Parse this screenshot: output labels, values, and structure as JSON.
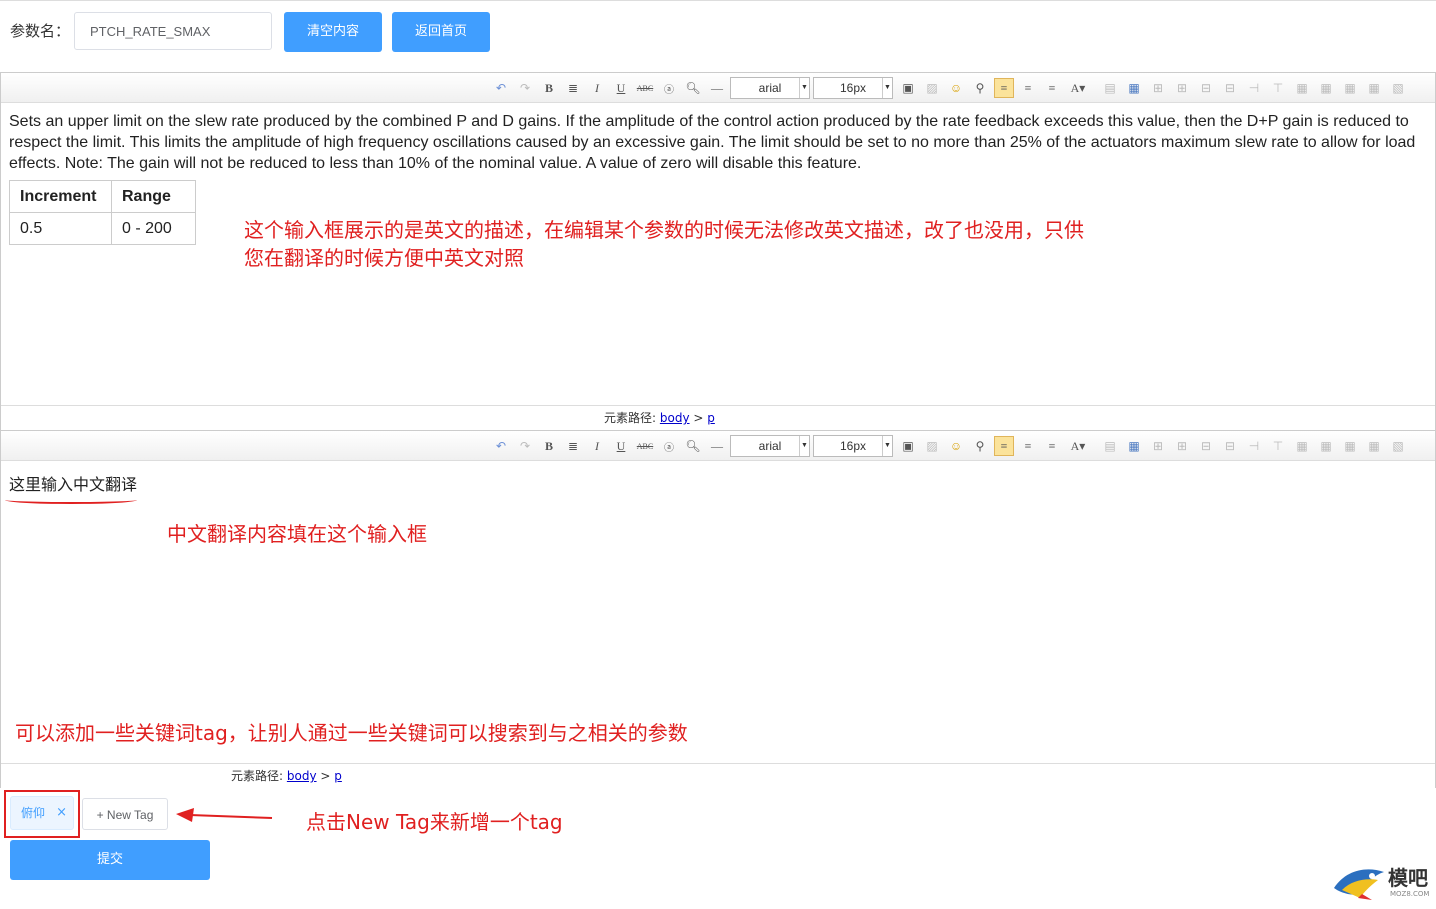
{
  "header": {
    "param_label": "参数名：",
    "param_value": "PTCH_RATE_SMAX",
    "clear_button": "清空内容",
    "home_button": "返回首页"
  },
  "toolbar": {
    "font_name": "arial",
    "font_size": "16px"
  },
  "editor_en": {
    "description": "Sets an upper limit on the slew rate produced by the combined P and D gains. If the amplitude of the control action produced by the rate feedback exceeds this value, then the D+P gain is reduced to respect the limit. This limits the amplitude of high frequency oscillations caused by an excessive gain. The limit should be set to no more than 25% of the actuators maximum slew rate to allow for load effects. Note: The gain will not be reduced to less than 10% of the nominal value. A value of zero will disable this feature.",
    "table_headers": [
      "Increment",
      "Range"
    ],
    "table_values": [
      "0.5",
      "0 - 200"
    ],
    "annotation_line1": "这个输入框展示的是英文的描述，在编辑某个参数的时候无法修改英文描述，改了也没用，只供",
    "annotation_line2": "您在翻译的时候方便中英文对照",
    "path_label": "元素路径:",
    "path_body": "body",
    "path_p": "p"
  },
  "editor_cn": {
    "placeholder_text": "这里输入中文翻译",
    "annotation": "中文翻译内容填在这个输入框",
    "tag_annotation": "可以添加一些关键词tag，让别人通过一些关键词可以搜索到与之相关的参数",
    "path_label": "元素路径:",
    "path_body": "body",
    "path_p": "p"
  },
  "tags": {
    "items": [
      "俯仰"
    ],
    "new_tag": "+ New Tag",
    "annotation": "点击New Tag来新增一个tag"
  },
  "submit_button": "提交",
  "logo": {
    "title": "模吧",
    "subtitle": "MOZ8.COM"
  },
  "colors": {
    "primary": "#409eff",
    "annotation": "#e02020"
  }
}
